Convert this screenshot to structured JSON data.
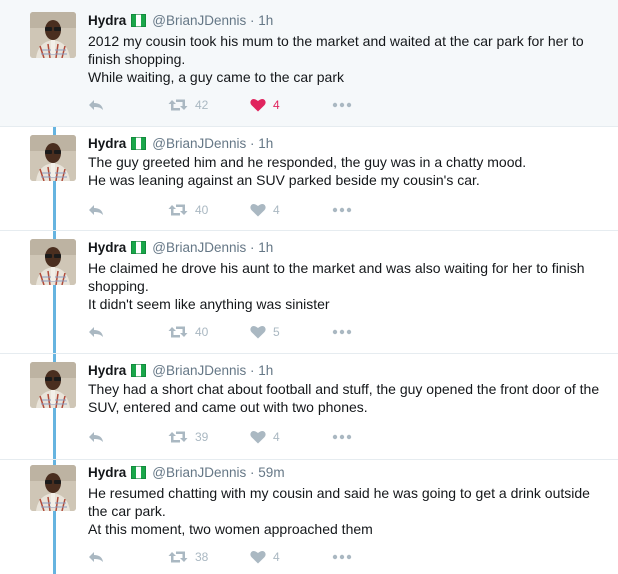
{
  "tweets": [
    {
      "name": "Hydra",
      "handle": "@BrianJDennis",
      "separator": "·",
      "time": "1h",
      "lines": [
        "2012 my cousin took his mum to the market and waited at the car park for her to finish shopping.",
        "While waiting, a guy came to the car park"
      ],
      "retweets": "42",
      "likes": "4",
      "liked": true
    },
    {
      "name": "Hydra",
      "handle": "@BrianJDennis",
      "separator": "·",
      "time": "1h",
      "lines": [
        "The guy greeted him and he responded, the guy was in a chatty mood.",
        "He was leaning against an SUV parked beside my cousin's car."
      ],
      "retweets": "40",
      "likes": "4",
      "liked": false
    },
    {
      "name": "Hydra",
      "handle": "@BrianJDennis",
      "separator": "·",
      "time": "1h",
      "lines": [
        "He claimed he drove his aunt to the market and was also waiting for her to finish shopping.",
        "It didn't seem like anything was sinister"
      ],
      "retweets": "40",
      "likes": "5",
      "liked": false
    },
    {
      "name": "Hydra",
      "handle": "@BrianJDennis",
      "separator": "·",
      "time": "1h",
      "lines": [
        "They had a short chat about football and stuff, the guy opened the front door of the SUV, entered and came out with two phones."
      ],
      "retweets": "39",
      "likes": "4",
      "liked": false
    },
    {
      "name": "Hydra",
      "handle": "@BrianJDennis",
      "separator": "·",
      "time": "59m",
      "lines": [
        "He resumed chatting with my cousin and said he was going to get a drink outside the car park.",
        "At this moment, two women approached them"
      ],
      "retweets": "38",
      "likes": "4",
      "liked": false
    }
  ],
  "icons": {
    "reply": "reply-icon",
    "retweet": "retweet-icon",
    "like": "heart-icon",
    "more": "more-icon",
    "flag": "nigeria-flag-icon"
  },
  "colors": {
    "like_active": "#e0245e",
    "thread_line": "#66b4e0",
    "muted": "#aab8c2",
    "handle": "#657786",
    "first_tweet_bg": "#f5f8fa"
  }
}
